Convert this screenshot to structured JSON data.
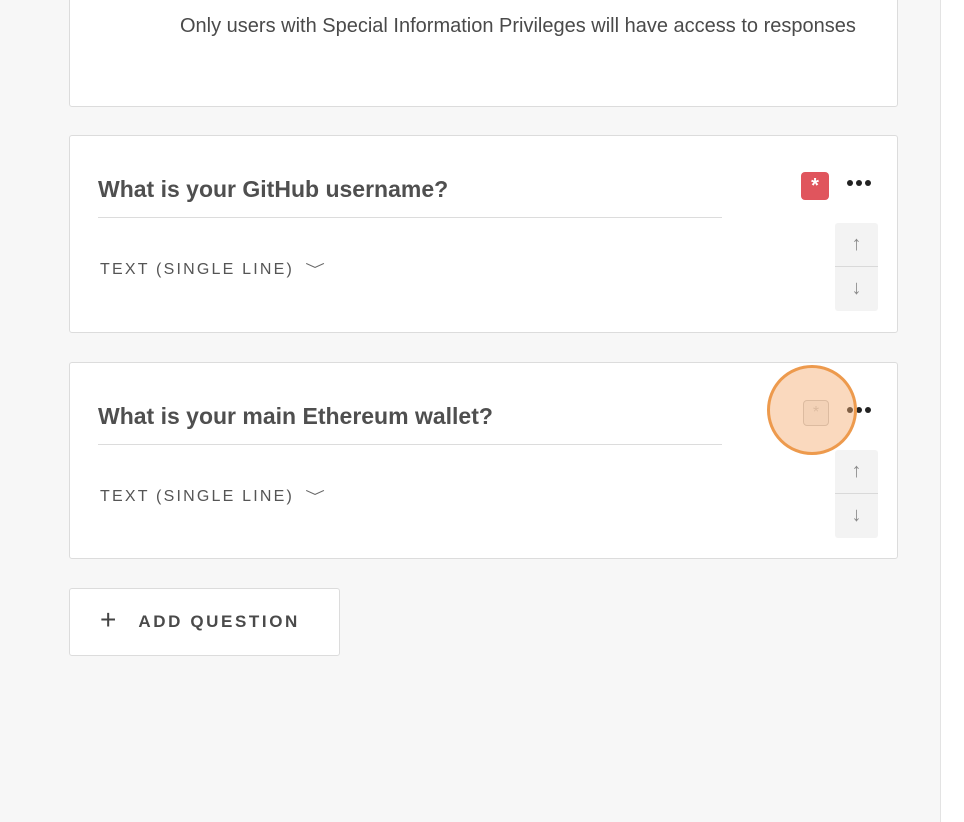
{
  "info": {
    "text": "Only users with Special Information Privileges will have access to responses"
  },
  "questions": [
    {
      "title": "What is your GitHub username?",
      "type_label": "TEXT (SINGLE LINE)",
      "required": true,
      "required_symbol": "*",
      "chevron": "﹀",
      "more_icon": "more-horizontal-icon",
      "up_arrow": "↑",
      "down_arrow": "↓"
    },
    {
      "title": "What is your main Ethereum wallet?",
      "type_label": "TEXT (SINGLE LINE)",
      "required": false,
      "required_symbol": "*",
      "chevron": "﹀",
      "more_icon": "more-horizontal-icon",
      "up_arrow": "↑",
      "down_arrow": "↓"
    }
  ],
  "add_question": {
    "icon": "+",
    "label": "ADD QUESTION"
  },
  "colors": {
    "required_active": "#e0555d",
    "cursor_highlight": "#ed9a4d",
    "background": "#f7f7f7"
  }
}
